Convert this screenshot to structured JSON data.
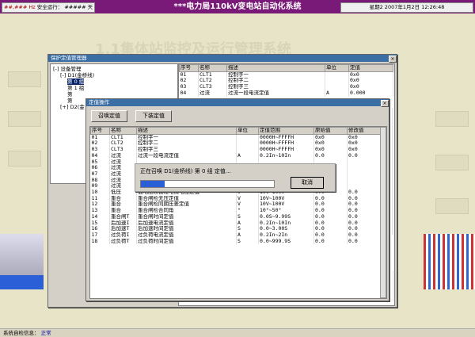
{
  "topbar": {
    "safe_label": "安全运行：",
    "safe_value": "##### 天",
    "hz": "##,### Hz",
    "title": "***电力局110kV变电站自动化系统",
    "datetime": "星期2 2007年1月2日 12:26:48"
  },
  "background": {
    "heading": "1.1集体站监控及运行管理系统"
  },
  "main_window": {
    "title": "保护定值管理器",
    "tree": [
      {
        "label": "设备管理",
        "indent": 0,
        "prefix": "-"
      },
      {
        "label": "D1(金桥线)",
        "indent": 1,
        "prefix": "-"
      },
      {
        "label": "第 0 组",
        "indent": 2,
        "prefix": "",
        "selected": true
      },
      {
        "label": "第 1 组",
        "indent": 2,
        "prefix": ""
      },
      {
        "label": "第",
        "indent": 2,
        "prefix": ""
      },
      {
        "label": "第",
        "indent": 2,
        "prefix": ""
      },
      {
        "label": "D2(金",
        "indent": 1,
        "prefix": "+"
      }
    ],
    "columns": [
      "序号",
      "名称",
      "描述",
      "单位",
      "定值"
    ],
    "top_rows": [
      [
        "01",
        "CLT1",
        "控制字一",
        "",
        "0x0"
      ],
      [
        "02",
        "CLT2",
        "控制字二",
        "",
        "0x0"
      ],
      [
        "03",
        "CLT3",
        "控制字三",
        "",
        "0x0"
      ],
      [
        "04",
        "过流",
        "过流一段电流定值",
        "A",
        "0.000"
      ]
    ],
    "right_rows": [
      [
        "",
        "",
        "",
        "",
        "0.000"
      ],
      [
        "",
        "",
        "",
        "",
        "0.000"
      ],
      [
        "",
        "",
        "",
        "",
        "0.000"
      ],
      [
        "",
        "",
        "",
        "",
        "0.000"
      ],
      [
        "",
        "",
        "",
        "",
        "0.000"
      ],
      [
        "",
        "",
        "",
        "",
        "0.000"
      ],
      [
        "",
        "",
        "",
        "",
        "0.000"
      ],
      [
        "",
        "",
        "",
        "",
        "0.000"
      ]
    ],
    "bottom_rows": [
      [
        "30",
        "失压T",
        "失压保护时间定值",
        "S",
        "0.000"
      ],
      [
        "31",
        "绝缘",
        "绝缘监察电压定值",
        "V",
        "0.000"
      ],
      [
        "32",
        "绝缘",
        "绝缘监察（或小电流选线）时间定值",
        "S",
        "0.000"
      ],
      [
        "33",
        "PT变比",
        "PT变比",
        "",
        "0.000"
      ],
      [
        "34",
        "CT变比",
        "CT变比",
        "",
        "0.000"
      ]
    ]
  },
  "dialog": {
    "title": "定值操作",
    "btn_read": "召唤定值",
    "btn_write": "下装定值",
    "columns": [
      "序号",
      "名称",
      "描述",
      "单位",
      "定值范围",
      "原始值",
      "修改值"
    ],
    "rows": [
      [
        "01",
        "CLT1",
        "控制字一",
        "",
        "0000H~FFFFH",
        "0x0",
        "0x0"
      ],
      [
        "02",
        "CLT2",
        "控制字二",
        "",
        "0000H~FFFFH",
        "0x0",
        "0x0"
      ],
      [
        "03",
        "CLT3",
        "控制字三",
        "",
        "0000H~FFFFH",
        "0x0",
        "0x0"
      ],
      [
        "04",
        "过流",
        "过流一段电流定值",
        "A",
        "0.2In~10In",
        "0.0",
        "0.0"
      ],
      [
        "05",
        "过流",
        "",
        "",
        "",
        "",
        ""
      ],
      [
        "06",
        "过流",
        "",
        "",
        "",
        "",
        ""
      ],
      [
        "07",
        "过流",
        "",
        "",
        "",
        "",
        ""
      ],
      [
        "08",
        "过流",
        "",
        "",
        "",
        "",
        ""
      ],
      [
        "09",
        "过流",
        "",
        "",
        "",
        "",
        ""
      ],
      [
        "10",
        "低压",
        "低电压闭锁过电流电压定值",
        "V",
        "10V~100V",
        "0.0",
        "0.0"
      ],
      [
        "11",
        "重合",
        "重合闸检无压定值",
        "V",
        "10V~100V",
        "0.0",
        "0.0"
      ],
      [
        "12",
        "重合",
        "重合闸检同期压差定值",
        "V",
        "10V~100V",
        "0.0",
        "0.0"
      ],
      [
        "13",
        "重合",
        "重合闸检合同角",
        "°",
        "10°~50°",
        "0.0",
        "0.0"
      ],
      [
        "14",
        "重合闸T",
        "重合闸时间定值",
        "S",
        "0.0S~9.99S",
        "0.0",
        "0.0"
      ],
      [
        "15",
        "后加速I",
        "后加速电流定值",
        "A",
        "0.2In~10In",
        "0.0",
        "0.0"
      ],
      [
        "16",
        "后加速T",
        "后加速时间定值",
        "S",
        "0.0~3.00S",
        "0.0",
        "0.0"
      ],
      [
        "17",
        "过负荷I",
        "过负荷电流定值",
        "A",
        "0.2In~2In",
        "0.0",
        "0.0"
      ],
      [
        "18",
        "过负荷T",
        "过负荷时间定值",
        "S",
        "0.0~999.9S",
        "0.0",
        "0.0"
      ]
    ]
  },
  "progress": {
    "message": "正在召唤 D1(金桥线) 第 0 组 定值...",
    "cancel": "取消",
    "percent": 18
  },
  "bottombar": {
    "label": "系统自检信息：",
    "value": "正常"
  },
  "colors": {
    "topbar": "#7a1a78",
    "titlebar": "#3a6ea5",
    "progress": "#2a5fd8"
  }
}
